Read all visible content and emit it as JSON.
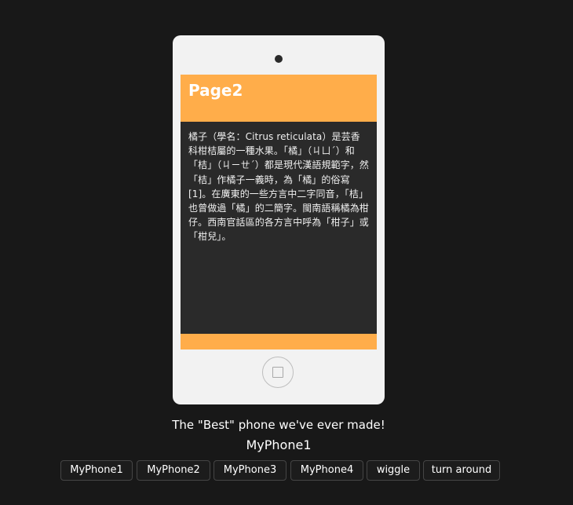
{
  "phone": {
    "screen": {
      "title": "Page2",
      "body_text": "橘子（學名：Citrus reticulata）是芸香科柑桔屬的一種水果。「橘」（ㄐㄩˊ）和「桔」（ㄐㄧㄝˊ）都是現代漢語規範字，然「桔」作橘子一義時，為「橘」的俗寫[1]。在廣東的一些方言中二字同音，「桔」也曾做過「橘」的二簡字。閩南語稱橘為柑仔。西南官話區的各方言中呼為「柑子」或「柑兒」。"
    },
    "colors": {
      "accent": "#ffad4a",
      "screen_bg": "#2a2a2a",
      "body_bg": "#f2f2f2"
    }
  },
  "tagline": "The \"Best\" phone we've ever made!",
  "model_name": "MyPhone1",
  "buttons": {
    "myphone1": "MyPhone1",
    "myphone2": "MyPhone2",
    "myphone3": "MyPhone3",
    "myphone4": "MyPhone4",
    "wiggle": "wiggle",
    "turn_around": "turn around"
  },
  "colors": {
    "page_bg": "#181818",
    "text": "#ffffff"
  }
}
